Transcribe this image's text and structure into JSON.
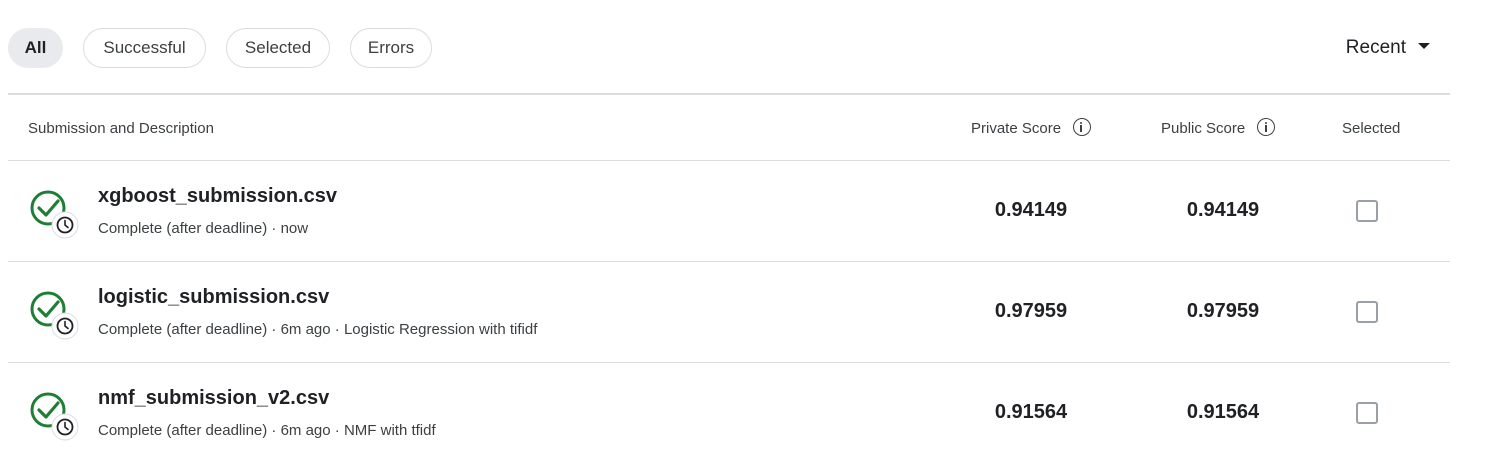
{
  "filters": {
    "all": "All",
    "successful": "Successful",
    "selected": "Selected",
    "errors": "Errors"
  },
  "sort": {
    "label": "Recent"
  },
  "table": {
    "headers": {
      "submission": "Submission and Description",
      "private_score": "Private Score",
      "public_score": "Public Score",
      "selected": "Selected"
    },
    "rows": [
      {
        "file": "xgboost_submission.csv",
        "meta": "Complete (after deadline) · now",
        "private_score": "0.94149",
        "public_score": "0.94149"
      },
      {
        "file": "logistic_submission.csv",
        "meta": "Complete (after deadline) · 6m ago · Logistic Regression with tifidf",
        "private_score": "0.97959",
        "public_score": "0.97959"
      },
      {
        "file": "nmf_submission_v2.csv",
        "meta": "Complete (after deadline) · 6m ago · NMF with tfidf",
        "private_score": "0.91564",
        "public_score": "0.91564"
      }
    ]
  },
  "icons": {
    "status": "check-clock-icon",
    "info": "info-icon",
    "caret": "caret-down-icon"
  },
  "colors": {
    "success_green": "#1e7e34",
    "chip_active_bg": "#e8eaed",
    "border": "#dadce0"
  }
}
